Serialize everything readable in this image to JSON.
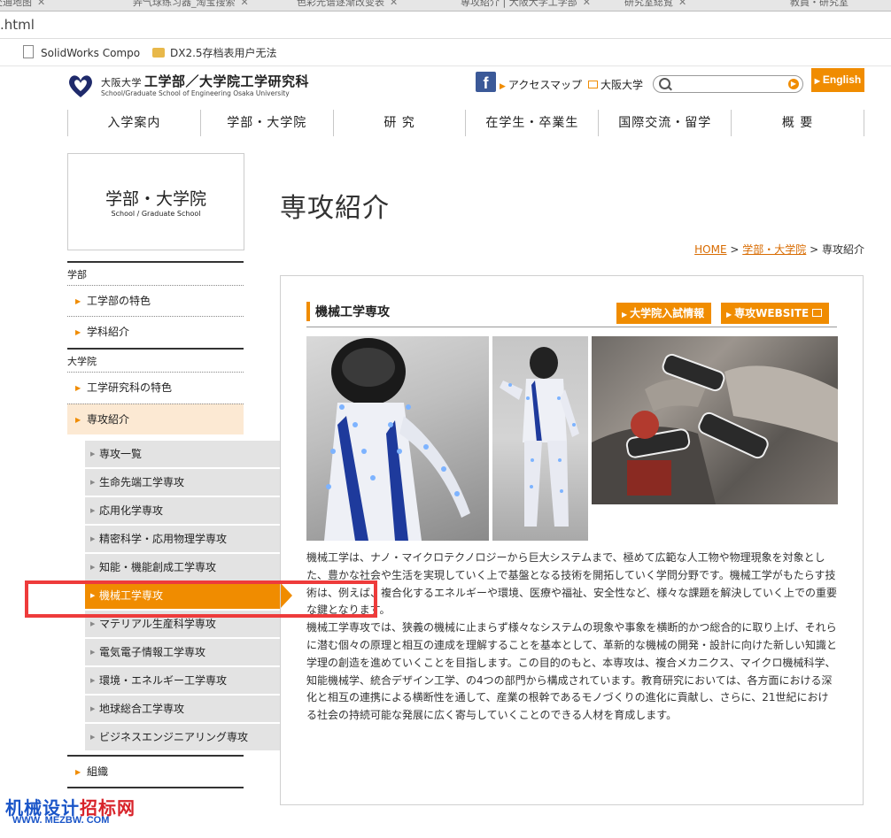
{
  "browser": {
    "tabs": [
      {
        "label": "交通地图"
      },
      {
        "label": "弄气球练习器_淘宝搜索"
      },
      {
        "label": "色彩光谱逐渐改变表"
      },
      {
        "label": "専攻紹介 | 大阪大学工学部"
      },
      {
        "label": "研究室総覧"
      },
      {
        "label": "教員・研究室"
      }
    ],
    "address": ".html",
    "bookmarks": [
      {
        "label": "SolidWorks Compo"
      },
      {
        "label": "DX2.5存档表用户无法"
      }
    ]
  },
  "header": {
    "logo_small": "大阪大学",
    "logo_main": "工学部／大学院工学研究科",
    "logo_en": "School/Graduate School of Engineering Osaka University",
    "access_map": "アクセスマップ",
    "univ_link": "大阪大学",
    "search_placeholder": "",
    "english": "English"
  },
  "gnav": [
    "入学案内",
    "学部・大学院",
    "研 究",
    "在学生・卒業生",
    "国際交流・留学",
    "概 要"
  ],
  "sidebar": {
    "title_jp": "学部・大学院",
    "title_en": "School / Graduate School",
    "section_undergrad": "学部",
    "undergrad_items": [
      "工学部の特色",
      "学科紹介"
    ],
    "section_grad": "大学院",
    "grad_items": [
      "工学研究科の特色",
      "専攻紹介"
    ],
    "sub_items": [
      "専攻一覧",
      "生命先端工学専攻",
      "応用化学専攻",
      "精密科学・応用物理学専攻",
      "知能・機能創成工学専攻",
      "機械工学専攻",
      "マテリアル生産科学専攻",
      "電気電子情報工学専攻",
      "環境・エネルギー工学専攻",
      "地球総合工学専攻",
      "ビジネスエンジニアリング専攻"
    ],
    "org": "組織"
  },
  "main": {
    "page_title": "専攻紹介",
    "breadcrumb": {
      "home": "HOME",
      "sep1": ">",
      "parent": "学部・大学院",
      "sep2": ">",
      "current": "専攻紹介"
    },
    "section_title": "機械工学専攻",
    "btn_admission": "大学院入試情報",
    "btn_website": "専攻WEBSITE",
    "para1": "機械工学は、ナノ・マイクロテクノロジーから巨大システムまで、極めて広範な人工物や物理現象を対象とした、豊かな社会や生活を実現していく上で基盤となる技術を開拓していく学問分野です。機械工学がもたらす技術は、例えば、複合化するエネルギーや環境、医療や福祉、安全性など、様々な課題を解決していく上での重要な鍵となります。",
    "para2": "機械工学専攻では、狭義の機械に止まらず様々なシステムの現象や事象を横断的かつ総合的に取り上げ、それらに潜む個々の原理と相互の連成を理解することを基本として、革新的な機械の開発・設計に向けた新しい知識と学理の創造を進めていくことを目指します。この目的のもと、本専攻は、複合メカニクス、マイクロ機械科学、知能機械学、統合デザイン工学、の4つの部門から構成されています。教育研究においては、各方面における深化と相互の連携による横断性を通して、産業の根幹であるモノづくりの進化に貢献し、さらに、21世紀における社会の持続可能な発展に広く寄与していくことのできる人材を育成します。"
  },
  "watermark": {
    "line1a": "机械设计",
    "line1b": "招标网",
    "line2": "WWW. MEZBW. COM"
  },
  "colors": {
    "accent": "#f08c00",
    "active_bg": "#fce9d3",
    "sub_bg": "#e3e3e3",
    "annotation": "#ee3b3b"
  }
}
